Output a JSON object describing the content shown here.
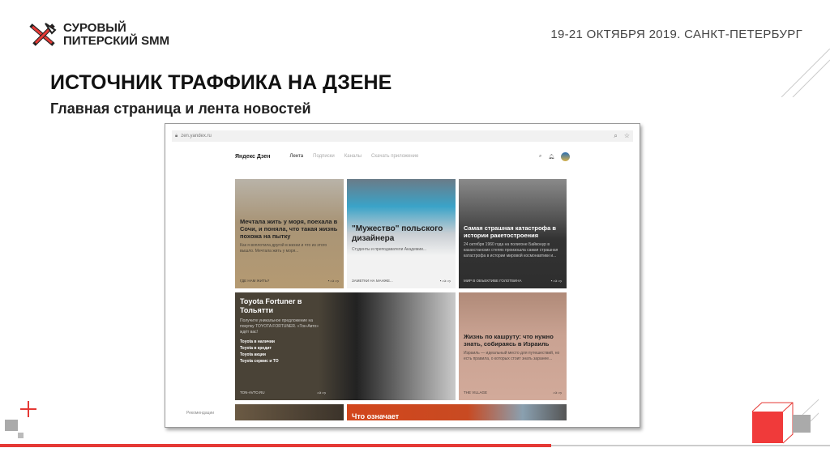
{
  "logo": {
    "line1": "СУРОВЫЙ",
    "line2": "ПИТЕРСКИЙ SMM"
  },
  "event": "19-21 ОКТЯБРЯ 2019. САНКТ-ПЕТЕРБУРГ",
  "title": "ИСТОЧНИК ТРАФФИКА НА ДЗЕНЕ",
  "subtitle": "Главная страница и лента новостей",
  "browser": {
    "url": "zen.yandex.ru",
    "search_icon": "search-icon",
    "star_icon": "star-icon"
  },
  "zen": {
    "brand": "Яндекс Дзен",
    "nav": [
      "Лента",
      "Подписки",
      "Каналы",
      "Скачать приложение"
    ],
    "side_label": "Рекомендации"
  },
  "cards": [
    {
      "title": "Мечтала жить у моря, поехала в Сочи, и поняла, что такая жизнь похожа на пытку",
      "text": "Как я воплотила другой в жизни и что из этого вышло. Мечтала жить у моря...",
      "source": "ГДЕ НАМ ЖИТЬ?"
    },
    {
      "title": "\"Мужество\" польского дизайнера",
      "text": "Студенты и преподаватели Академии...",
      "source": "ЗАМЕТКИ НА МАНЖЕ..."
    },
    {
      "title": "Самая страшная катастрофа в истории ракетостроения",
      "text": "24 октября 1960 года на полигоне Байконур в казахстанских степях произошла самая страшная катастрофа в истории мировой космонавтики и...",
      "source": "МИР В ОБЪЕКТИВЕ ГОЛОТВИНА"
    },
    {
      "title": "Toyota Fortuner в Тольятти",
      "text": "Получите уникальное предложение на покупку TOYOTA FORTUNER. «Тон-Авто» ждёт вас!",
      "links": [
        "Toyota в наличии",
        "Toyota в кредит",
        "Toyota акции",
        "Toyota сервис и ТО"
      ],
      "source": "TON-AVTO.RU"
    },
    {
      "title": "Жизнь по кашруту: что нужно знать, собираясь в Израиль",
      "text": "Израиль — идеальный место для путешествий, но есть правила, о которых стоит знать заранее...",
      "source": "THE VILLAGE"
    },
    {
      "title": "Что означает"
    }
  ]
}
